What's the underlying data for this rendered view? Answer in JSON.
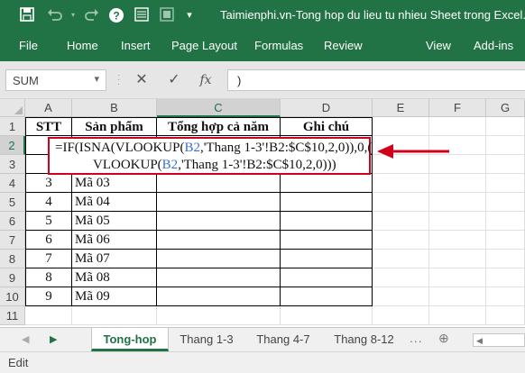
{
  "title_bar": {
    "title": "Taimienphi.vn-Tong hop du lieu tu nhieu Sheet trong Excel.xls",
    "icons": [
      "save-icon",
      "undo-icon",
      "redo-icon",
      "help-icon",
      "form-icon",
      "customize-icon"
    ]
  },
  "menu": {
    "items": [
      "File",
      "Home",
      "Insert",
      "Page Layout",
      "Formulas",
      "Review",
      "View",
      "Add-ins"
    ]
  },
  "formula_bar": {
    "name_box": "SUM",
    "cancel_symbol": "✕",
    "enter_symbol": "✓",
    "fx_symbol": "fx",
    "content": ")"
  },
  "columns": [
    "A",
    "B",
    "C",
    "D",
    "E",
    "F",
    "G"
  ],
  "rows": [
    "1",
    "2",
    "3",
    "4",
    "5",
    "6",
    "7",
    "8",
    "9",
    "10",
    "11"
  ],
  "table": {
    "headers": [
      "STT",
      "Sản phẩm",
      "Tổng hợp cả năm",
      "Ghi chú"
    ],
    "data": [
      {
        "stt": "3",
        "product": "Mã 03"
      },
      {
        "stt": "4",
        "product": "Mã 04"
      },
      {
        "stt": "5",
        "product": "Mã 05"
      },
      {
        "stt": "6",
        "product": "Mã 06"
      },
      {
        "stt": "7",
        "product": "Mã 07"
      },
      {
        "stt": "8",
        "product": "Mã 08"
      },
      {
        "stt": "9",
        "product": "Mã 09"
      }
    ]
  },
  "formula_overlay": {
    "line1_a": "=IF(ISNA(VLOOKUP(",
    "line1_ref": "B2",
    "line1_b": ",'Thang 1-3'!B2:$C$10,2,0)),0,(",
    "line2_a": "VLOOKUP(",
    "line2_ref": "B2",
    "line2_b": ",'Thang 1-3'!B2:$C$10,2,0)))"
  },
  "sheets": {
    "tabs": [
      "Tong-hop",
      "Thang 1-3",
      "Thang 4-7",
      "Thang 8-12"
    ],
    "active": "Tong-hop",
    "more": "..."
  },
  "status": {
    "mode": "Edit"
  },
  "colors": {
    "excel_green": "#217346",
    "highlight_red": "#d0021b",
    "ref_blue": "#3b6fd0"
  }
}
